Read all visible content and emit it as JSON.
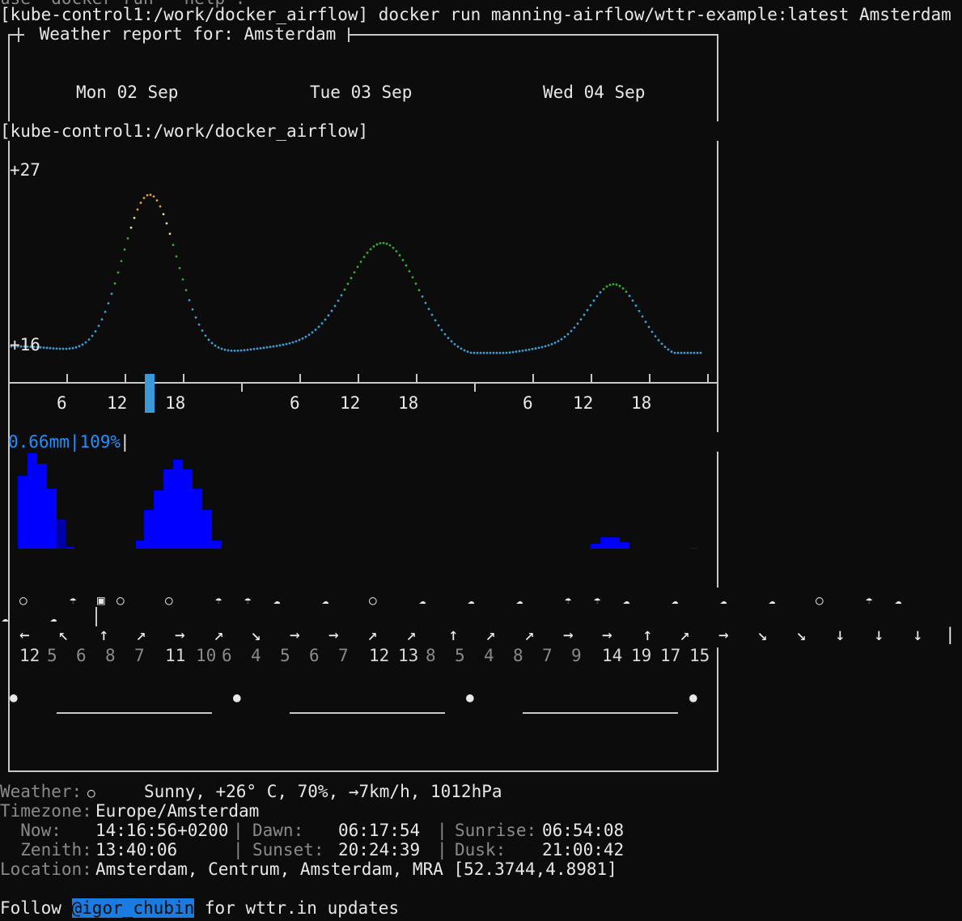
{
  "prompt": {
    "cut_top": "use `docker run --help'.",
    "line1": "[kube-control1:/work/docker_airflow] docker run manning-airflow/wttr-example:latest Amsterdam",
    "line2": "[kube-control1:/work/docker_airflow]"
  },
  "report": {
    "title": " Weather report for: Amsterdam ",
    "days": [
      "Mon 02 Sep",
      "Tue 03 Sep",
      "Wed 04 Sep"
    ]
  },
  "temperature_chart": {
    "max_label": "+27",
    "min_label": "+16",
    "hour_labels": [
      "6",
      "12",
      "18",
      "6",
      "12",
      "18",
      "6",
      "12",
      "18"
    ]
  },
  "precip": {
    "label": "0.66mm|109%",
    "cursor": "|"
  },
  "wind": {
    "arrows": [
      "←",
      "↖",
      "↑",
      "↗",
      "→",
      "↗",
      "↘",
      "→",
      "→",
      "↗",
      "↗",
      "↑",
      "↗",
      "↗",
      "→",
      "→",
      "↑",
      "↗",
      "→",
      "↘",
      "↘",
      "↓",
      "↓",
      "↓",
      "|"
    ],
    "speeds": [
      "12",
      "5",
      "6",
      "8",
      "7",
      "11",
      "10",
      "6",
      "4",
      "5",
      "6",
      "7",
      "12",
      "13",
      "8",
      "5",
      "4",
      "8",
      "7",
      "9",
      "14",
      "19",
      "17",
      "15"
    ]
  },
  "info": {
    "weather_label": "Weather:",
    "weather_value": "Sunny, +26° C, 70%, →7km/h, 1012hPa",
    "timezone_label": "Timezone:",
    "timezone_value": "Europe/Amsterdam",
    "now_label": "  Now:",
    "now_value": "14:16:56+0200",
    "dawn_label": "Dawn:",
    "dawn_value": "06:17:54",
    "sunrise_label": "Sunrise:",
    "sunrise_value": "06:54:08",
    "zenith_label": "  Zenith:",
    "zenith_value": "13:40:06",
    "sunset_label": "Sunset:",
    "sunset_value": "20:24:39",
    "dusk_label": "Dusk:",
    "dusk_value": "21:00:42",
    "location_label": "Location:",
    "location_value": "Amsterdam, Centrum, Amsterdam, MRA [52.3744,4.8981]",
    "follow_prefix": "Follow ",
    "follow_handle": "@igor_chubin",
    "follow_suffix": " for wttr.in updates"
  },
  "colors": {
    "precip_bar": "#0000ff",
    "precip_label": "#1e90ff",
    "cursor_marker": "#3a9ad9"
  }
}
